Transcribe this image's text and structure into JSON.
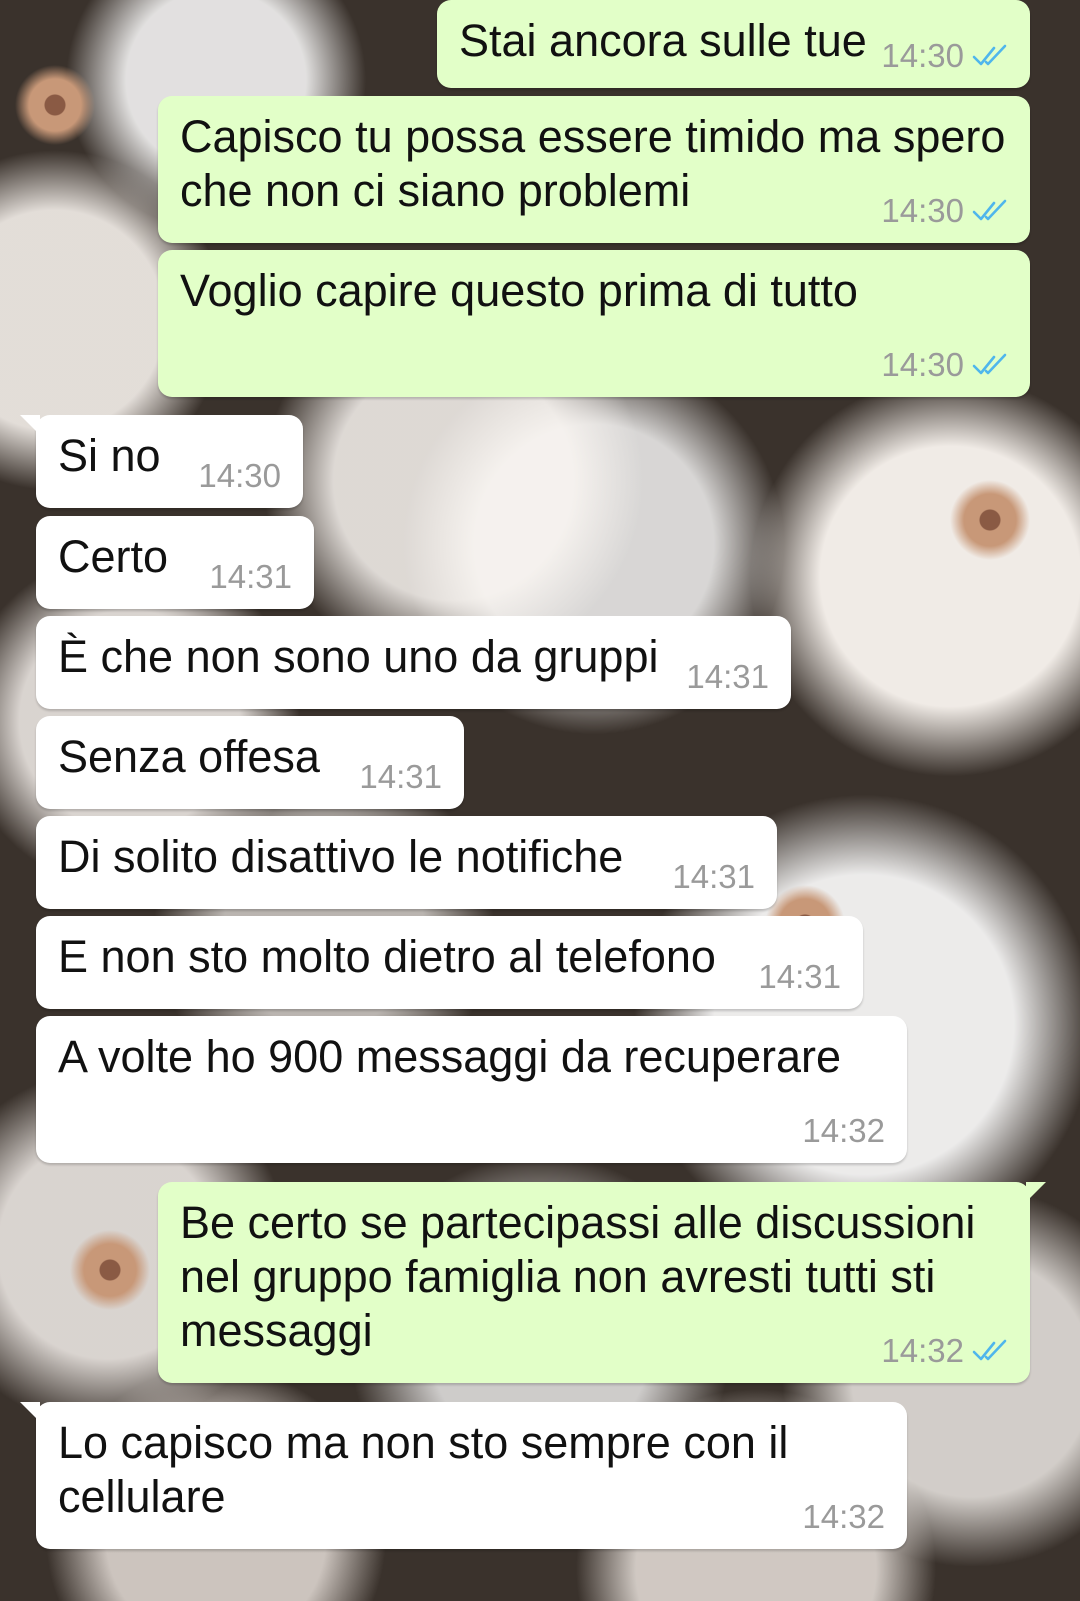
{
  "messages": [
    {
      "text": "Stai ancora sulle tue",
      "time": "14:30",
      "direction": "outgoing",
      "status": "read"
    },
    {
      "text": "Capisco tu possa essere timido ma spero che non ci siano problemi",
      "time": "14:30",
      "direction": "outgoing",
      "status": "read"
    },
    {
      "text": "Voglio capire questo prima di tutto",
      "time": "14:30",
      "direction": "outgoing",
      "status": "read"
    },
    {
      "text": "Si no",
      "time": "14:30",
      "direction": "incoming"
    },
    {
      "text": "Certo",
      "time": "14:31",
      "direction": "incoming"
    },
    {
      "text": "È che non sono uno da gruppi",
      "time": "14:31",
      "direction": "incoming"
    },
    {
      "text": "Senza offesa",
      "time": "14:31",
      "direction": "incoming"
    },
    {
      "text": "Di solito disattivo le notifiche",
      "time": "14:31",
      "direction": "incoming"
    },
    {
      "text": "E non sto molto dietro al telefono",
      "time": "14:31",
      "direction": "incoming"
    },
    {
      "text": "A volte ho 900 messaggi da recuperare",
      "time": "14:32",
      "direction": "incoming"
    },
    {
      "text": "Be certo se partecipassi alle discussioni nel gruppo famiglia non avresti tutti sti messaggi",
      "time": "14:32",
      "direction": "outgoing",
      "status": "read"
    },
    {
      "text": "Lo capisco ma non sto sempre con il cellulare",
      "time": "14:32",
      "direction": "incoming"
    }
  ],
  "colors": {
    "outgoing_bubble": "#e2ffc8",
    "incoming_bubble": "#ffffff",
    "read_tick": "#4fb6ec",
    "timestamp": "#9a9a9a"
  },
  "icons": {
    "read_receipt": "double-check-icon"
  }
}
